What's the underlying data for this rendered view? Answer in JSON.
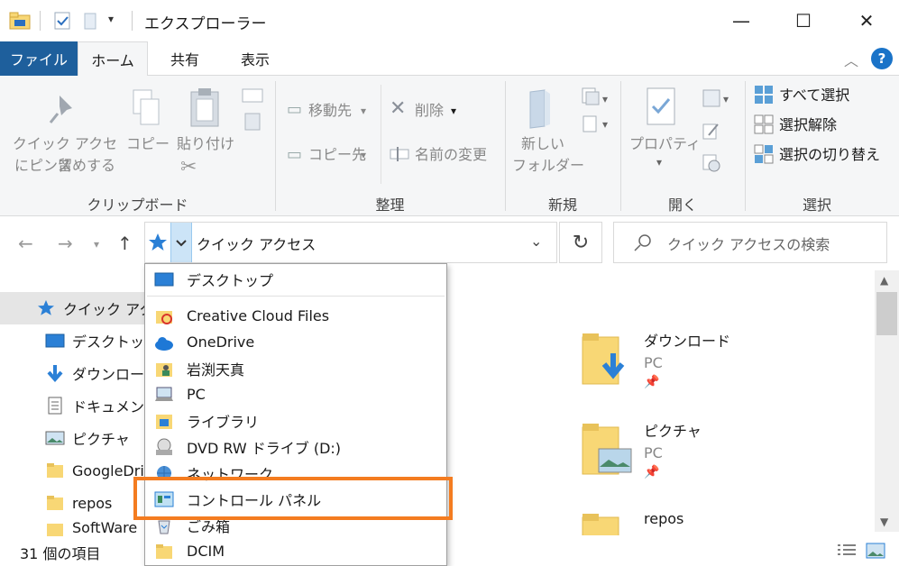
{
  "window": {
    "title": "エクスプローラー",
    "minimize": "—",
    "maximize": "☐",
    "close": "✕"
  },
  "tabs": {
    "file": "ファイル",
    "home": "ホーム",
    "share": "共有",
    "view": "表示"
  },
  "help": "?",
  "ribbon": {
    "clipboard": {
      "pin_line1": "クイック アクセス",
      "pin_line2": "にピン留めする",
      "copy": "コピー",
      "paste": "貼り付け",
      "label": "クリップボード"
    },
    "organize": {
      "move_to": "移動先",
      "copy_to": "コピー先",
      "delete": "削除",
      "rename": "名前の変更",
      "label": "整理"
    },
    "new": {
      "new_folder_line1": "新しい",
      "new_folder_line2": "フォルダー",
      "label": "新規"
    },
    "open": {
      "properties": "プロパティ",
      "label": "開く"
    },
    "select": {
      "select_all": "すべて選択",
      "select_none": "選択解除",
      "invert": "選択の切り替え",
      "label": "選択"
    }
  },
  "address": {
    "path": "クイック アクセス",
    "search_placeholder": "クイック アクセスの検索"
  },
  "nav_pane": [
    "クイック アクセス",
    "デスクトップ",
    "ダウンロード",
    "ドキュメント",
    "ピクチャ",
    "GoogleDrive",
    "repos",
    "SoftWare"
  ],
  "content": {
    "tiles": [
      {
        "name": "ダウンロード",
        "sub": "PC"
      },
      {
        "name": "ピクチャ",
        "sub": "PC"
      },
      {
        "name": "repos",
        "sub": ""
      }
    ]
  },
  "dropdown": {
    "items": [
      "デスクトップ",
      "Creative Cloud Files",
      "OneDrive",
      "岩渕天真",
      "PC",
      "ライブラリ",
      "DVD RW ドライブ (D:)",
      "ネットワーク",
      "コントロール パネル",
      "ごみ箱",
      "DCIM"
    ],
    "highlighted": "コントロール パネル"
  },
  "status": {
    "item_count": "31 個の項目"
  },
  "colors": {
    "file_tab": "#1e5f9c",
    "highlight_border": "#f47c20",
    "folder": "#f8d775",
    "accent_blue": "#1a73c8"
  }
}
